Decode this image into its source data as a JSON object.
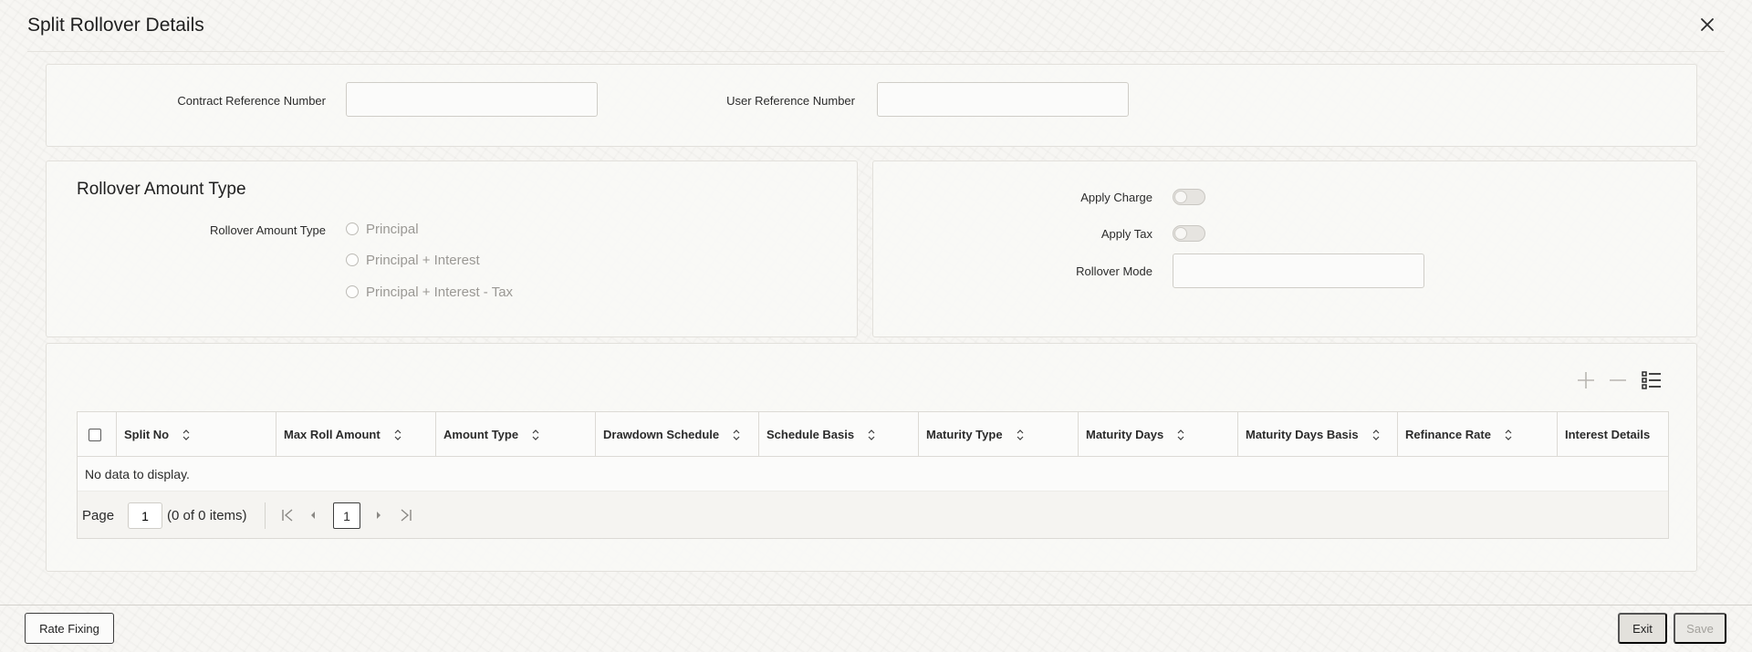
{
  "header": {
    "title": "Split Rollover Details"
  },
  "reference": {
    "contract_ref_label": "Contract Reference Number",
    "contract_ref_value": "",
    "user_ref_label": "User Reference Number",
    "user_ref_value": ""
  },
  "rollover_amount": {
    "section_title": "Rollover Amount Type",
    "field_label": "Rollover Amount Type",
    "options": [
      "Principal",
      "Principal + Interest",
      "Principal + Interest - Tax"
    ],
    "selected": null
  },
  "charges": {
    "apply_charge_label": "Apply Charge",
    "apply_charge_on": false,
    "apply_tax_label": "Apply Tax",
    "apply_tax_on": false,
    "rollover_mode_label": "Rollover Mode",
    "rollover_mode_value": ""
  },
  "grid": {
    "toolbar": {
      "add_icon": "plus-icon",
      "remove_icon": "minus-icon",
      "view_icon": "list-view-icon"
    },
    "columns": [
      "Split No",
      "Max Roll Amount",
      "Amount Type",
      "Drawdown Schedule",
      "Schedule Basis",
      "Maturity Type",
      "Maturity Days",
      "Maturity Days Basis",
      "Refinance Rate",
      "Interest Details"
    ],
    "rows": [],
    "empty_message": "No data to display.",
    "pager": {
      "page_label": "Page",
      "page_value": "1",
      "count_text": "(0 of 0 items)",
      "current_page": "1"
    }
  },
  "footer": {
    "rate_fixing_label": "Rate Fixing",
    "exit_label": "Exit",
    "save_label": "Save"
  },
  "colors": {
    "background": "#f7f6f3",
    "panel": "#f9f8f6",
    "border": "#e2e0db",
    "text": "#2b2b2b",
    "disabled_text": "#9a9894"
  }
}
